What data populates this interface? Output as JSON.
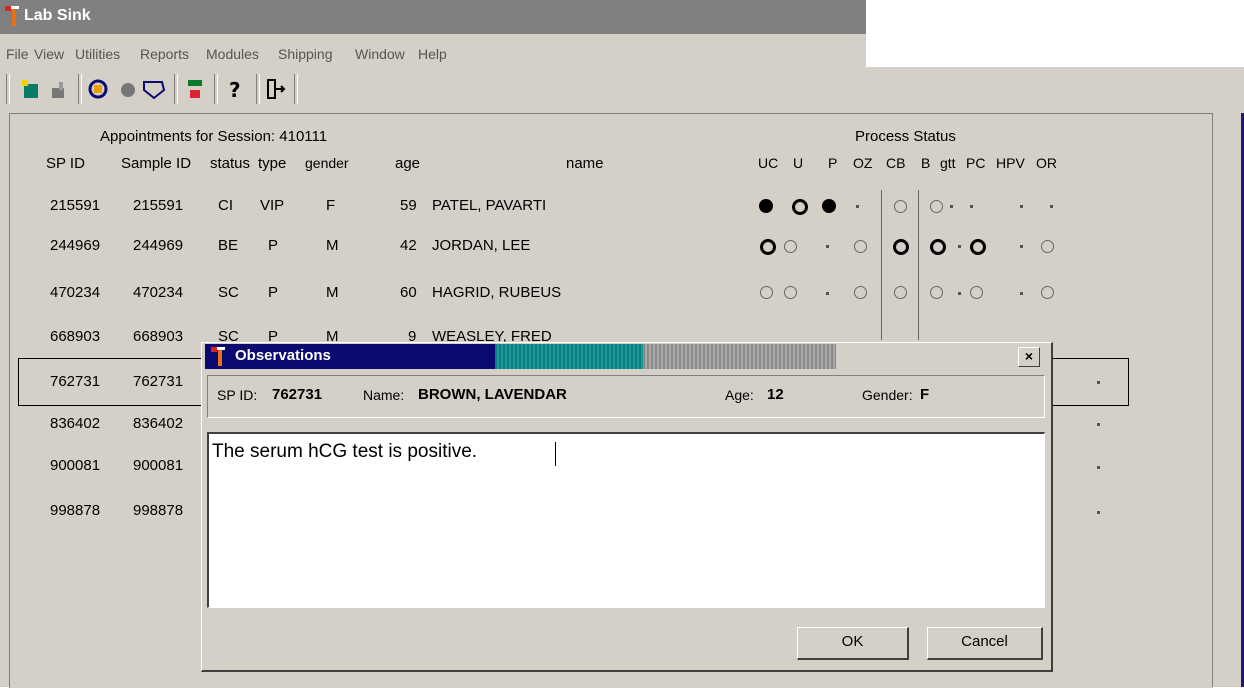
{
  "app": {
    "title": "Lab Sink",
    "menu": [
      "File",
      "View",
      "Utilities",
      "Reports",
      "Modules",
      "Shipping",
      "Window",
      "Help"
    ]
  },
  "toolbar": {
    "icons": [
      "new-icon",
      "open-icon",
      "find-icon",
      "stop-icon",
      "label-icon",
      "transfer-icon",
      "help-icon",
      "exit-icon"
    ]
  },
  "appointments": {
    "heading": "Appointments for Session: 410111",
    "process_status_heading": "Process Status",
    "columns": [
      "SP ID",
      "Sample ID",
      "status",
      "type",
      "gender",
      "age",
      "name"
    ],
    "status_columns": [
      "UC",
      "U",
      "P",
      "OZ",
      "CB",
      "B",
      "gtt",
      "PC",
      "HPV",
      "OR"
    ],
    "rows": [
      {
        "sp_id": "215591",
        "sample_id": "215591",
        "status": "CI",
        "type": "VIP",
        "gender": "F",
        "age": "59",
        "name": "PATEL, PAVARTI"
      },
      {
        "sp_id": "244969",
        "sample_id": "244969",
        "status": "BE",
        "type": "P",
        "gender": "M",
        "age": "42",
        "name": "JORDAN, LEE"
      },
      {
        "sp_id": "470234",
        "sample_id": "470234",
        "status": "SC",
        "type": "P",
        "gender": "M",
        "age": "60",
        "name": "HAGRID, RUBEUS"
      },
      {
        "sp_id": "668903",
        "sample_id": "668903",
        "status": "SC",
        "type": "P",
        "gender": "M",
        "age": "9",
        "name": "WEASLEY, FRED"
      },
      {
        "sp_id": "762731",
        "sample_id": "762731"
      },
      {
        "sp_id": "836402",
        "sample_id": "836402"
      },
      {
        "sp_id": "900081",
        "sample_id": "900081"
      },
      {
        "sp_id": "998878",
        "sample_id": "998878"
      }
    ]
  },
  "dialog": {
    "title": "Observations",
    "sp_id_label": "SP ID:",
    "sp_id": "762731",
    "name_label": "Name:",
    "name": "BROWN, LAVENDAR",
    "age_label": "Age:",
    "age": "12",
    "gender_label": "Gender:",
    "gender": "F",
    "observation_text": "The serum hCG test is positive.",
    "ok_label": "OK",
    "cancel_label": "Cancel",
    "close_label": "×"
  }
}
